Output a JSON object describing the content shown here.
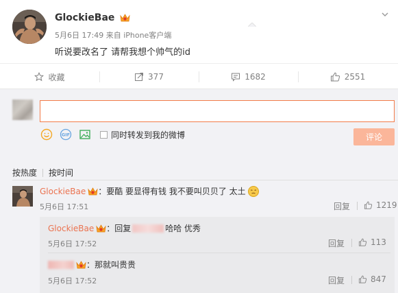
{
  "post": {
    "username": "GlockieBae",
    "date": "5月6日 17:49",
    "source": "来自 iPhone客户端",
    "text": "听说要改名了 请帮我想个帅气的id"
  },
  "actions": {
    "favorite": "收藏",
    "repost": "377",
    "comment": "1682",
    "like": "2551"
  },
  "composer": {
    "input_value": "",
    "repost_checkbox_label": "同时转发到我的微博",
    "submit_label": "评论"
  },
  "sort": {
    "by_hot": "按热度",
    "by_time": "按时间"
  },
  "comments": [
    {
      "username": "GlockieBae",
      "text": "：要酷 要显得有钱 我不要叫贝贝了 太土",
      "time": "5月6日 17:51",
      "reply_label": "回复",
      "likes": "1219"
    }
  ],
  "replies": [
    {
      "username": "GlockieBae",
      "text_prefix": "：回复",
      "text_suffix": "哈哈 优秀",
      "time": "5月6日 17:52",
      "reply_label": "回复",
      "likes": "113"
    },
    {
      "text": "：那就叫贵贵",
      "time": "5月6日 17:52",
      "reply_label": "回复",
      "likes": "847"
    }
  ],
  "colors": {
    "accent": "#eb7350",
    "input_border": "#f37b48",
    "submit_disabled": "#fbb69a",
    "comment_bg": "#f2f2f5"
  }
}
